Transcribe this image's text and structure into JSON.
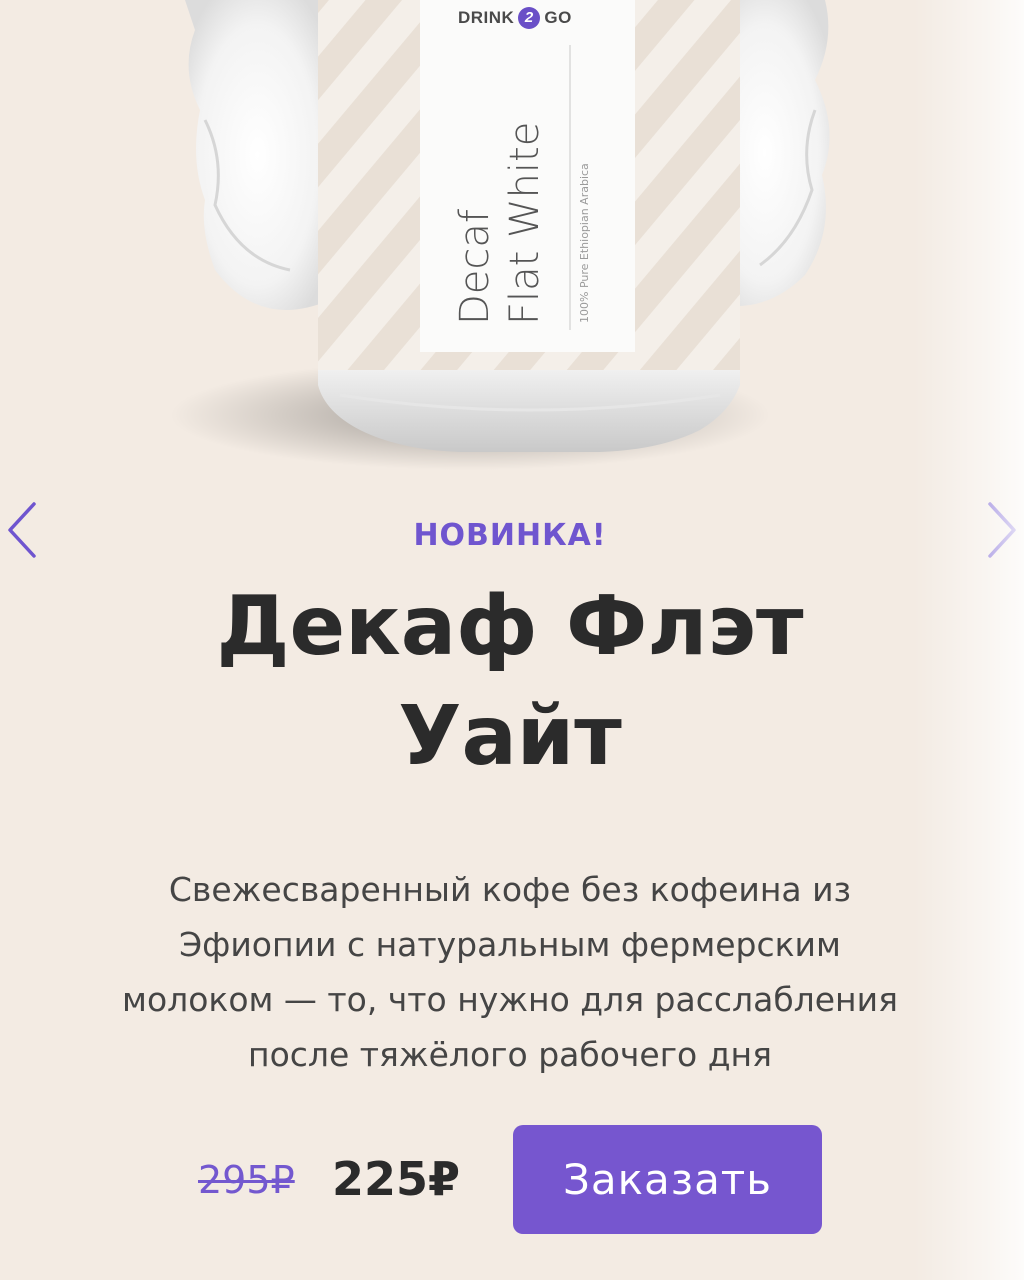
{
  "hero": {
    "brand": {
      "left": "DRINK",
      "mid": "2",
      "right": "GO"
    },
    "can_label": {
      "line1": "Decaf",
      "line2": "Flat White",
      "subtitle": "100% Pure Ethiopian Arabica"
    }
  },
  "slider": {
    "prev_icon": "chevron-left-icon",
    "next_icon": "chevron-right-icon"
  },
  "product": {
    "badge": "НОВИНКА!",
    "title_line1": "Декаф Флэт",
    "title_line2": "Уайт",
    "description": [
      "Свежесваренный кофе без кофеина из",
      "Эфиопии с натуральным фермерским",
      "молоком — то, что нужно для расслабления",
      "после тяжёлого рабочего дня"
    ],
    "price_old": "295₽",
    "price_new": "225₽",
    "order_label": "Заказать"
  },
  "colors": {
    "background": "#f3ebe3",
    "accent": "#7656cf",
    "text": "#2b2b2b"
  }
}
